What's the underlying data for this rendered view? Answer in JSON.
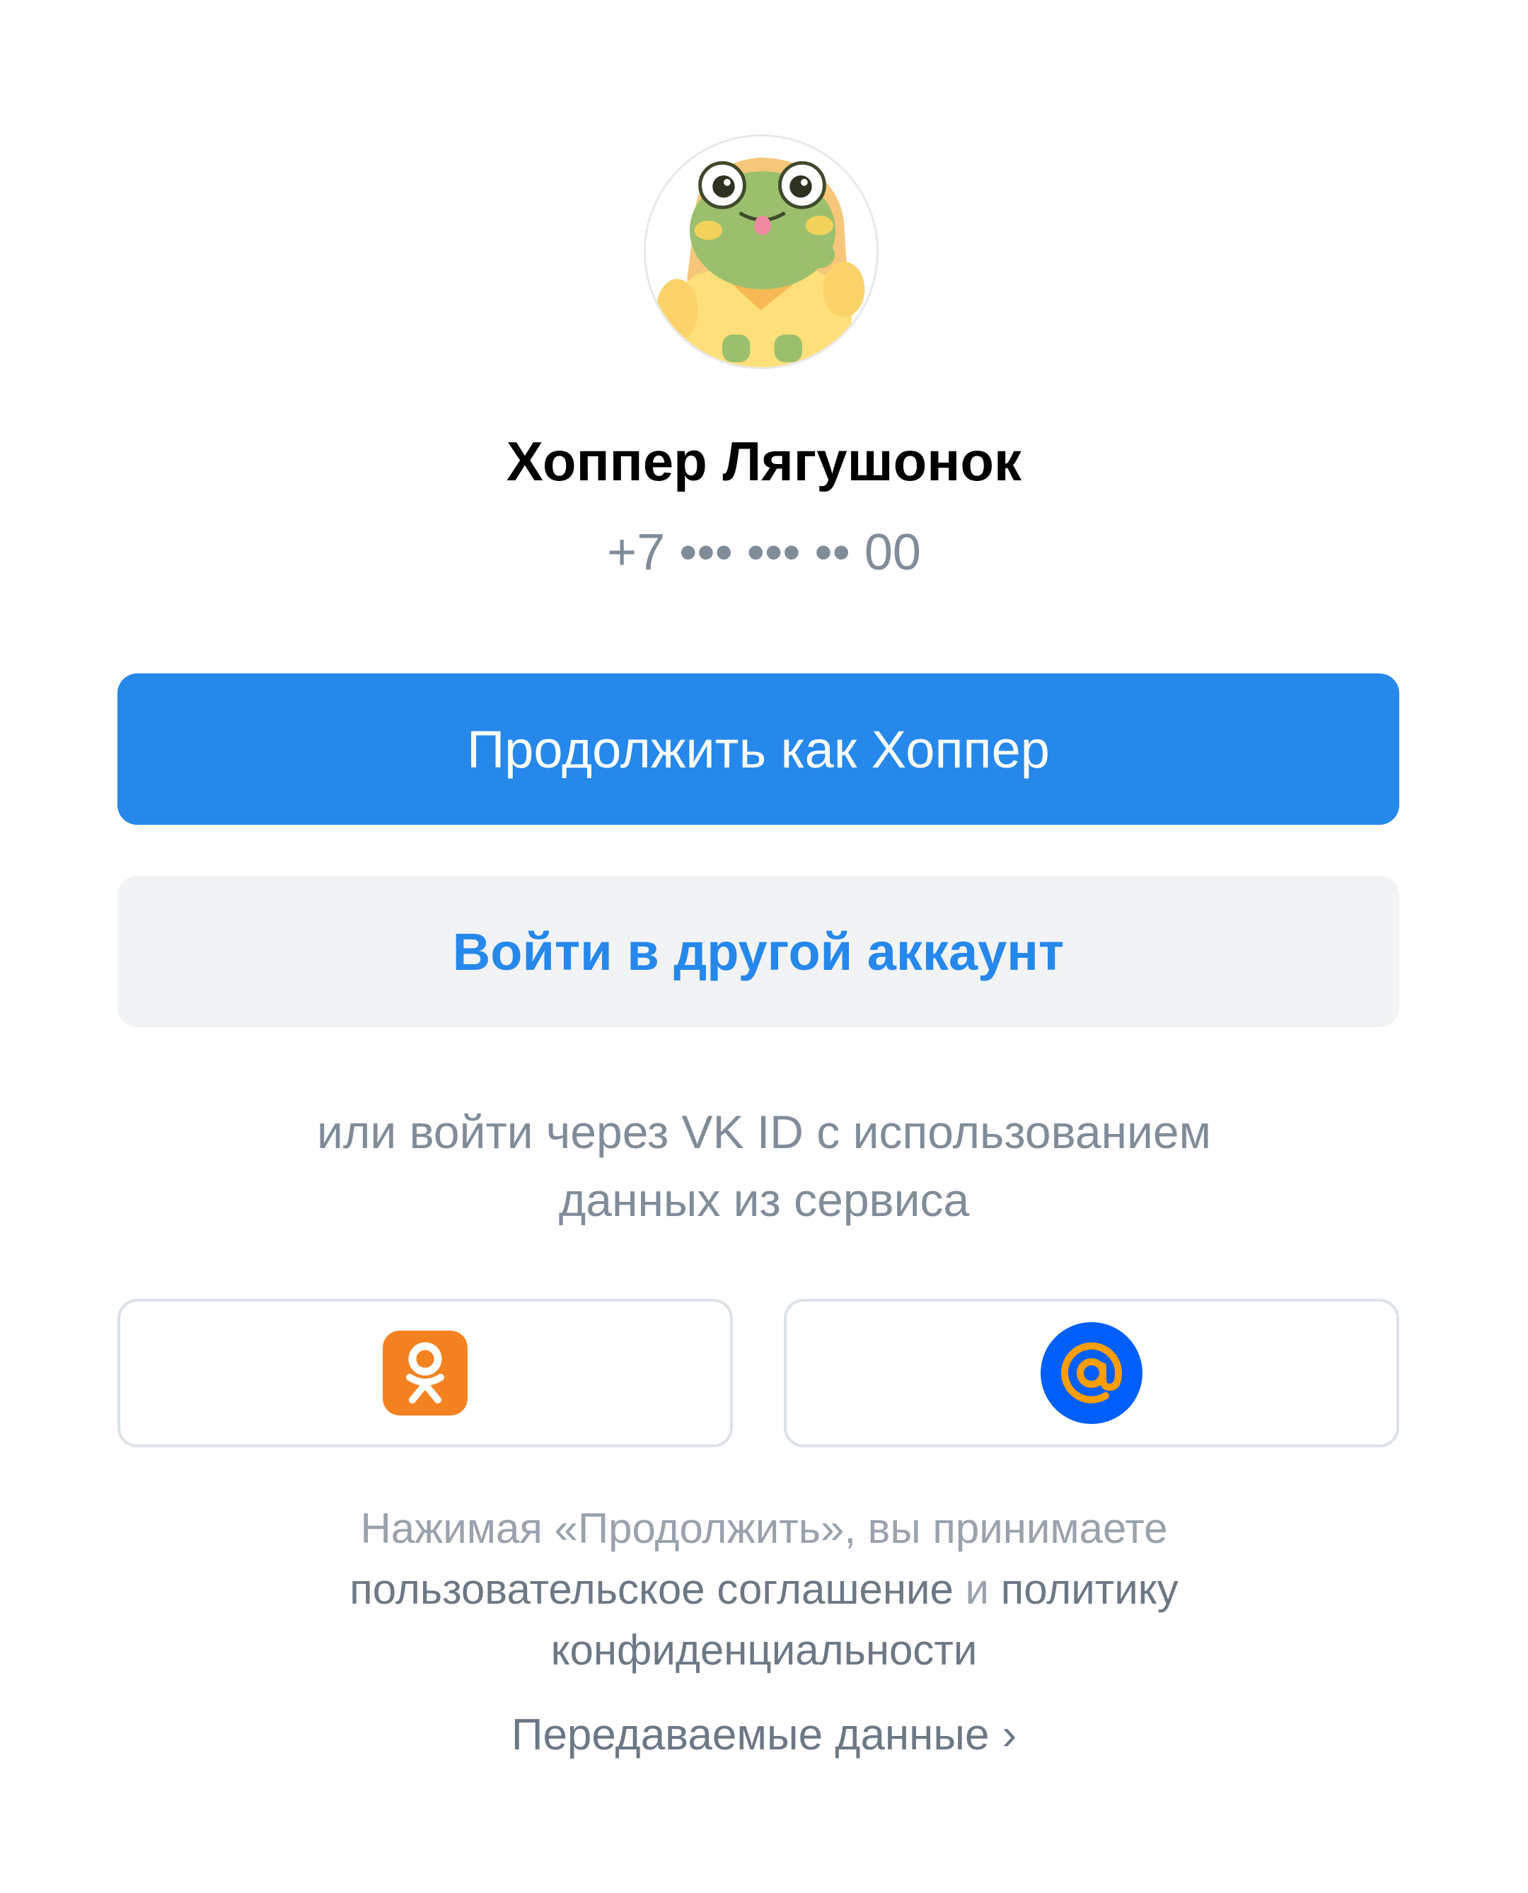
{
  "profile": {
    "name": "Хоппер Лягушонок",
    "phone": "+7 ••• ••• •• 00",
    "avatar": "frog-avatar-icon"
  },
  "actions": {
    "continue_label": "Продолжить как Хоппер",
    "other_account_label": "Войти в другой аккаунт"
  },
  "alternative": {
    "line1": "или войти через VK ID с использованием",
    "line2": "данных из сервиса"
  },
  "social": [
    {
      "name": "ok-icon",
      "color": "#f58220"
    },
    {
      "name": "mail-icon",
      "color": "#005ff9",
      "accent": "#ff9e00"
    }
  ],
  "legal": {
    "prefix": "Нажимая «Продолжить», вы принимаете",
    "terms_link": "пользовательское соглашение",
    "and": "и",
    "privacy_link_part1": "политику",
    "privacy_link_part2": "конфиденциальности"
  },
  "transferred_data": {
    "label": "Передаваемые данные",
    "icon": "chevron-right-icon"
  },
  "colors": {
    "primary": "#2688eb",
    "secondary_bg": "#f2f3f5",
    "muted_text": "#818c99"
  }
}
